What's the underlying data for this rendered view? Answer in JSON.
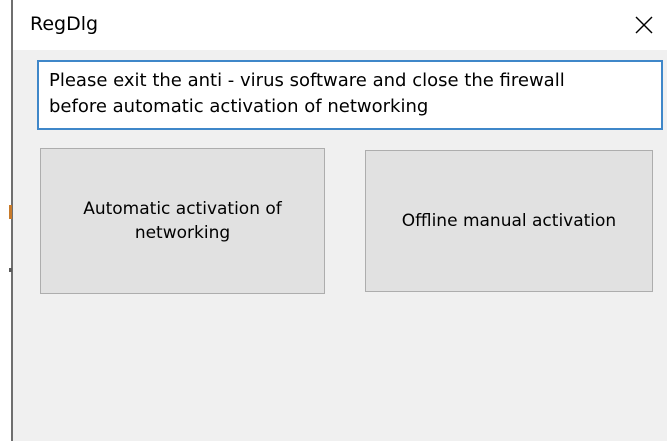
{
  "window": {
    "title": "RegDlg",
    "close_icon": "close-icon"
  },
  "message": {
    "line1": "Please exit the anti - virus software and close the firewall",
    "line2": "before automatic activation of networking"
  },
  "buttons": {
    "auto_activation_label": "Automatic activation of networking",
    "offline_activation_label": "Offline manual activation"
  },
  "colors": {
    "message_border": "#3f87c9",
    "button_face": "#e1e1e1",
    "button_border": "#adadad",
    "dialog_background": "#f0f0f0"
  }
}
